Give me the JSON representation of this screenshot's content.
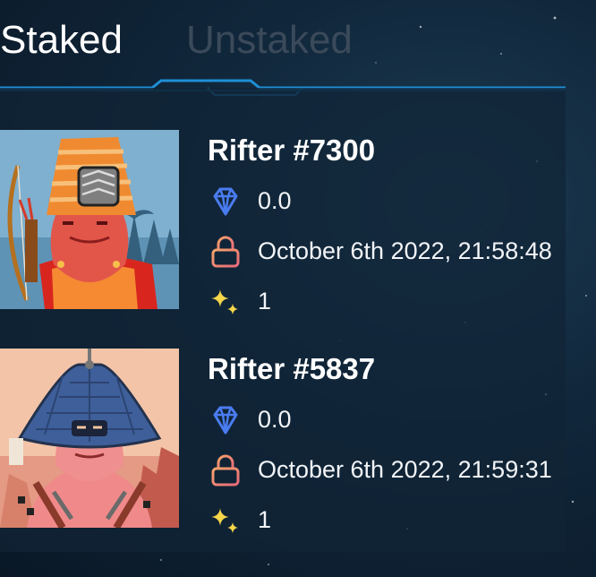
{
  "tabs": {
    "staked": "Staked",
    "unstaked": "Unstaked",
    "active": "staked"
  },
  "colors": {
    "accent_blue": "#1e8fd6",
    "inactive_tab": "#3b4a5a",
    "gem": "#4a7cf0",
    "lock": "#f08a6a",
    "sparkle": "#f7d64a"
  },
  "nfts": [
    {
      "name": "Rifter #7300",
      "reward": "0.0",
      "staked_at": "October 6th 2022, 21:58:48",
      "multiplier": "1",
      "icons": [
        "gem-icon",
        "lock-icon",
        "sparkles-icon"
      ]
    },
    {
      "name": "Rifter #5837",
      "reward": "0.0",
      "staked_at": "October 6th 2022, 21:59:31",
      "multiplier": "1",
      "icons": [
        "gem-icon",
        "lock-icon",
        "sparkles-icon"
      ]
    }
  ]
}
